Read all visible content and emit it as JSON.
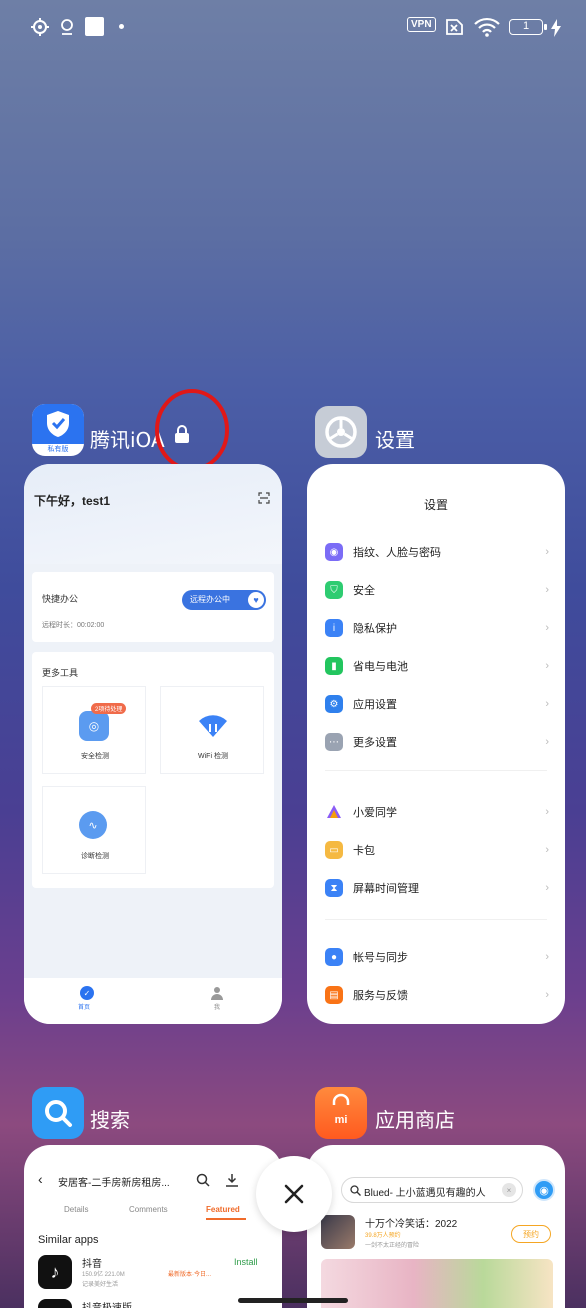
{
  "status_bar": {
    "vpn": "VPN",
    "battery": "1"
  },
  "apps": [
    {
      "name": "腾讯iOA",
      "icon": "tencent-ioa-logo",
      "icon_label": "私有版",
      "preview": {
        "greeting": "下午好，test1",
        "quick_office": "快捷办公",
        "remote_pill": "远程办公中",
        "duration": "远程时长：00:02:00",
        "more_tools": "更多工具",
        "tools": [
          {
            "label": "安全检测",
            "badge": "2项待处理"
          },
          {
            "label": "WiFi 检测"
          },
          {
            "label": "诊断检测"
          }
        ],
        "nav": [
          "首页",
          "我"
        ]
      }
    },
    {
      "name": "设置",
      "icon": "gear-icon",
      "preview": {
        "title": "设置",
        "groups": [
          [
            {
              "label": "指纹、人脸与密码",
              "color": "#7b6cf6"
            },
            {
              "label": "安全",
              "color": "#2ecc71"
            },
            {
              "label": "隐私保护",
              "color": "#3b82f6"
            },
            {
              "label": "省电与电池",
              "color": "#22c55e"
            },
            {
              "label": "应用设置",
              "color": "#2f80ed"
            },
            {
              "label": "更多设置",
              "color": "#9aa3b2"
            }
          ],
          [
            {
              "label": "小爱同学",
              "color": "#8b5cf6"
            },
            {
              "label": "卡包",
              "color": "#f5b942"
            },
            {
              "label": "屏幕时间管理",
              "color": "#3b82f6"
            }
          ],
          [
            {
              "label": "帐号与同步",
              "color": "#3b82f6"
            },
            {
              "label": "服务与反馈",
              "color": "#f97316"
            }
          ]
        ]
      }
    },
    {
      "name": "搜索",
      "icon": "search-icon",
      "preview": {
        "title": "安居客-二手房新房租房...",
        "tabs": [
          "Details",
          "Comments",
          "Featured"
        ],
        "similar": "Similar apps",
        "apps": [
          {
            "name": "抖音",
            "meta": "150.9亿  221.0M",
            "tag": "最新版本·今日...",
            "sub": "记录美好生活",
            "action": "Install"
          },
          {
            "name": "抖音极速版"
          }
        ]
      }
    },
    {
      "name": "应用商店",
      "icon": "mi-store-icon",
      "preview": {
        "search_text": "Blued- 上小蓝遇见有趣的人",
        "promo_title": "十万个冷笑话：2022",
        "promo_sub": "39.8万人预约",
        "promo_desc": "一剑不太正经的冒险",
        "promo_action": "预约"
      }
    }
  ],
  "close_label": "close-all"
}
